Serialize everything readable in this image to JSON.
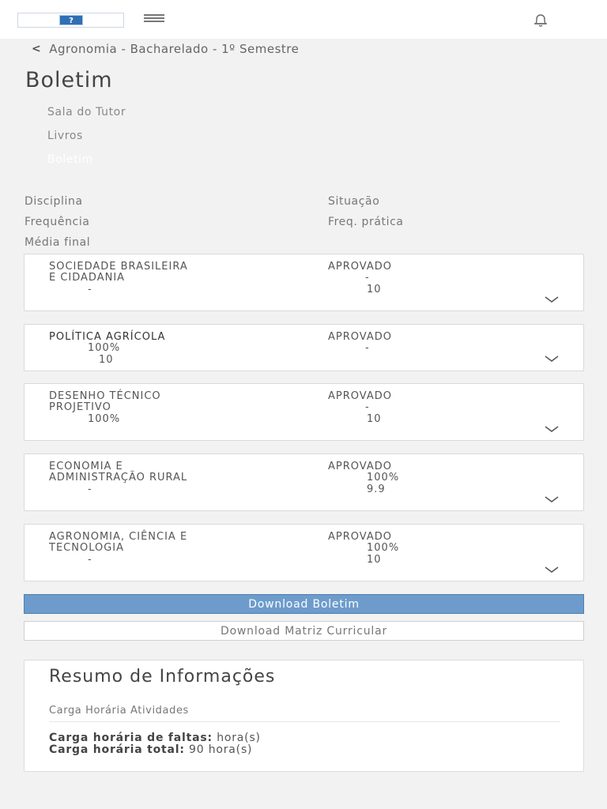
{
  "header": {
    "logo_text": "?",
    "breadcrumb": "Agronomia - Bacharelado - 1º Semestre",
    "title": "Boletim"
  },
  "nav": [
    {
      "label": "Sala do Tutor"
    },
    {
      "label": "Livros"
    },
    {
      "label": "Boletim"
    }
  ],
  "table_headers": {
    "disciplina": "Disciplina",
    "situacao": "Situação",
    "frequencia": "Frequência",
    "freq_pratica": "Freq. prática",
    "media_final": "Média final"
  },
  "courses": [
    {
      "name_line1": "SOCIEDADE BRASILEIRA",
      "name_line2": "E CIDADANIA",
      "situation": "APROVADO",
      "freq_pratica": "-",
      "frequencia": "-",
      "media": "10"
    },
    {
      "name_line1": "POLÍTICA AGRÍCOLA",
      "situation": "APROVADO",
      "frequencia": "100%",
      "freq_pratica": "-",
      "media": "10"
    },
    {
      "name_line1": "DESENHO TÉCNICO",
      "name_line2": "PROJETIVO",
      "situation": "APROVADO",
      "freq_pratica": "-",
      "frequencia": "100%",
      "media": "10"
    },
    {
      "name_line1": "ECONOMIA E",
      "name_line2": "ADMINISTRAÇÃO RURAL",
      "situation": "APROVADO",
      "freq_pratica": "100%",
      "frequencia": "-",
      "media": "9.9"
    },
    {
      "name_line1": "AGRONOMIA, CIÊNCIA E",
      "name_line2": "TECNOLOGIA",
      "situation": "APROVADO",
      "freq_pratica": "100%",
      "frequencia": "-",
      "media": "10"
    }
  ],
  "buttons": {
    "download_boletim": "Download Boletim",
    "download_matriz": "Download Matriz Curricular"
  },
  "summary": {
    "title": "Resumo de Informações",
    "subtitle": "Carga Horária Atividades",
    "faltas_label": "Carga horária de faltas:",
    "faltas_value": "hora(s)",
    "total_label": "Carga horária total:",
    "total_value": "90 hora(s)"
  },
  "colors": {
    "primary_button": "#6d9ccc",
    "background": "#f2f2f2",
    "logo": "#2f6fb4"
  },
  "icons": [
    "hamburger-menu-icon",
    "bell-icon",
    "chevron-left-icon",
    "chevron-down-icon"
  ]
}
